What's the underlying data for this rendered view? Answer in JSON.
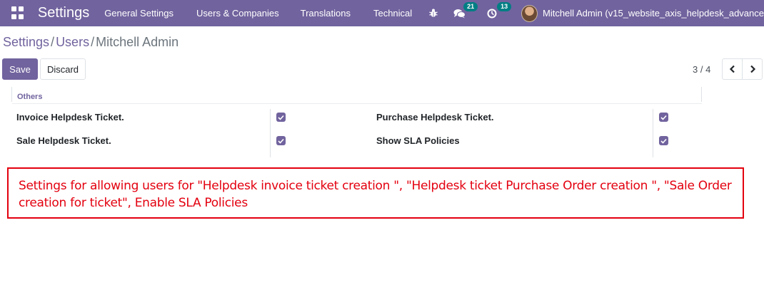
{
  "navbar": {
    "apps_icon": "apps-grid-icon",
    "brand": "Settings",
    "menu": [
      "General Settings",
      "Users & Companies",
      "Translations",
      "Technical"
    ],
    "icons": {
      "debug": "bug-icon",
      "messages": "chat-bubbles-icon",
      "activities": "clock-icon"
    },
    "messages_count": "21",
    "activities_count": "13",
    "user_name": "Mitchell Admin (v15_website_axis_helpdesk_advance"
  },
  "breadcrumb": {
    "items": [
      "Settings",
      "Users"
    ],
    "current": "Mitchell Admin",
    "separator": "/"
  },
  "actions": {
    "save": "Save",
    "discard": "Discard"
  },
  "pager": {
    "value": "3 / 4",
    "prev_icon": "chevron-left-icon",
    "next_icon": "chevron-right-icon"
  },
  "section": {
    "title": "Others",
    "fields": [
      {
        "label": "Invoice Helpdesk Ticket.",
        "checked": true
      },
      {
        "label": "Purchase Helpdesk Ticket.",
        "checked": true
      },
      {
        "label": "Sale Helpdesk Ticket.",
        "checked": true
      },
      {
        "label": "Show SLA Policies",
        "checked": true
      }
    ]
  },
  "annotation": {
    "text": "Settings for allowing users for \"Helpdesk invoice ticket creation \", \"Helpdesk ticket Purchase Order creation \", \"Sale Order creation for ticket\", Enable SLA Policies",
    "color": "#e3000f"
  },
  "colors": {
    "brand": "#71639e",
    "badge": "#017e84"
  }
}
